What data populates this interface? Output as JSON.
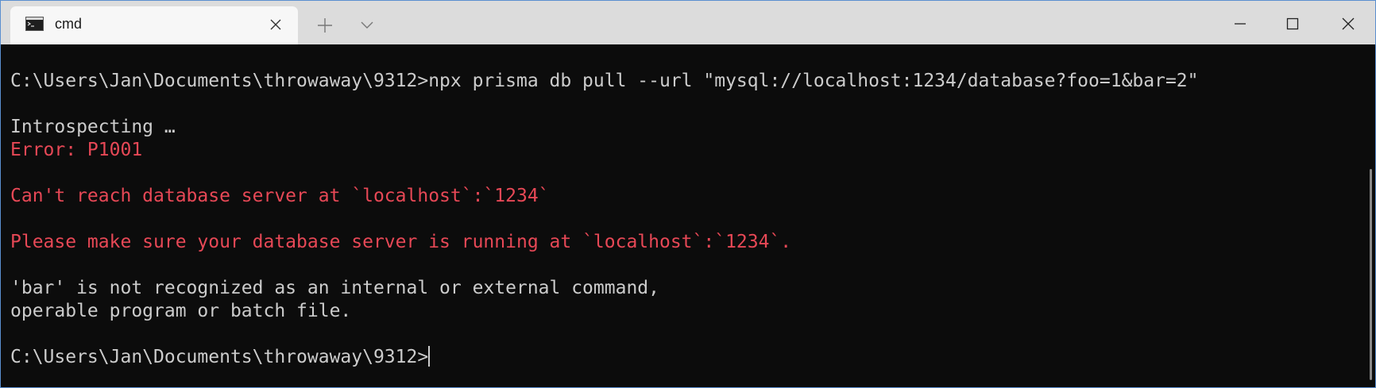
{
  "tab": {
    "title": "cmd",
    "icon": "terminal-icon"
  },
  "titlebar_icons": {
    "close_tab": "close-icon",
    "new_tab": "plus-icon",
    "dropdown": "chevron-down-icon",
    "minimize": "minimize-icon",
    "maximize": "maximize-icon",
    "close_window": "close-icon"
  },
  "colors": {
    "terminal_background": "#0c0c0c",
    "text": "#cccccc",
    "error": "#e74856"
  },
  "terminal": {
    "lines": [
      {
        "text": "",
        "type": "normal"
      },
      {
        "text": "C:\\Users\\Jan\\Documents\\throwaway\\9312>npx prisma db pull --url \"mysql://localhost:1234/database?foo=1&bar=2\"",
        "type": "normal"
      },
      {
        "text": "",
        "type": "normal"
      },
      {
        "text": "Introspecting …",
        "type": "normal"
      },
      {
        "text": "Error: P1001",
        "type": "error"
      },
      {
        "text": "",
        "type": "normal"
      },
      {
        "text": "Can't reach database server at `localhost`:`1234`",
        "type": "error"
      },
      {
        "text": "",
        "type": "normal"
      },
      {
        "text": "Please make sure your database server is running at `localhost`:`1234`.",
        "type": "error"
      },
      {
        "text": "",
        "type": "normal"
      },
      {
        "text": "'bar' is not recognized as an internal or external command,",
        "type": "normal"
      },
      {
        "text": "operable program or batch file.",
        "type": "normal"
      },
      {
        "text": "",
        "type": "normal"
      }
    ],
    "prompt": "C:\\Users\\Jan\\Documents\\throwaway\\9312>"
  }
}
